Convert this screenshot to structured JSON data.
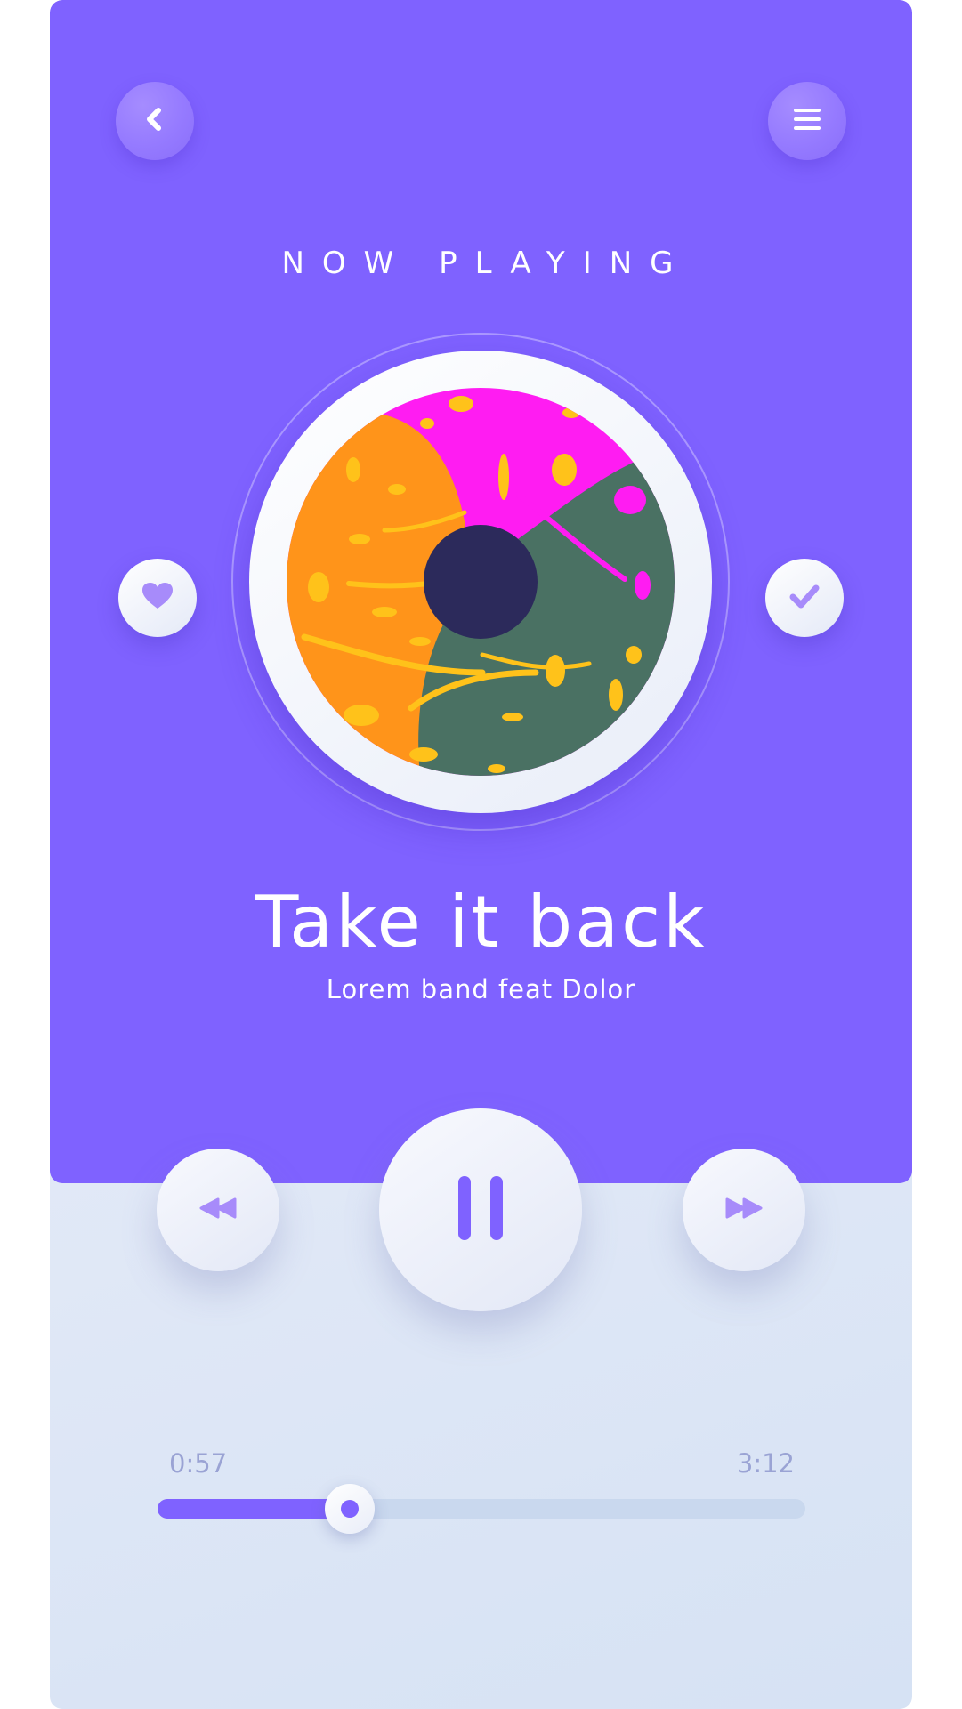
{
  "header": {
    "title": "NOW PLAYING",
    "back_icon": "chevron-left-icon",
    "menu_icon": "hamburger-menu-icon"
  },
  "track": {
    "title": "Take it back",
    "artist": "Lorem band feat Dolor"
  },
  "actions": {
    "like_icon": "heart-icon",
    "check_icon": "checkmark-icon"
  },
  "controls": {
    "rewind_icon": "rewind-icon",
    "pause_icon": "pause-icon",
    "forward_icon": "fast-forward-icon"
  },
  "progress": {
    "elapsed": "0:57",
    "total": "3:12",
    "fraction": 0.297
  },
  "colors": {
    "accent": "#7f62ff",
    "background": "#e4eaf7",
    "art_orange": "#ff941a",
    "art_magenta": "#ff1cf2",
    "art_green": "#4a7163",
    "art_yellow": "#ffc21a",
    "disc_center": "#2c2a5b"
  }
}
